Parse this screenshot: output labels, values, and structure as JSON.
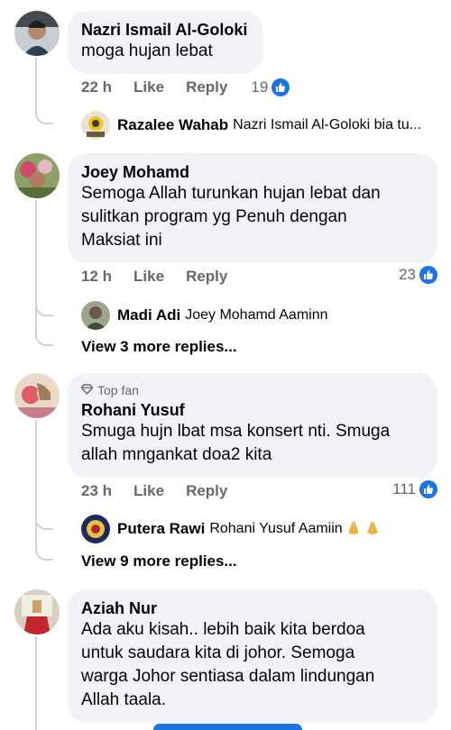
{
  "comments": [
    {
      "author": "Nazri Ismail Al-Goloki",
      "text": "moga hujan lebat",
      "time": "22 h",
      "like_label": "Like",
      "reply_label": "Reply",
      "reactions": "19",
      "reply_preview": {
        "name": "Razalee Wahab",
        "text": "Nazri Ismail Al-Goloki bia tu..."
      }
    },
    {
      "author": "Joey Mohamd",
      "text": "Semoga Allah turunkan hujan lebat dan\nsulitkan program yg Penuh dengan\nMaksiat ini",
      "time": "12 h",
      "like_label": "Like",
      "reply_label": "Reply",
      "reactions": "23",
      "reply_preview": {
        "name": "Madi Adi",
        "text": "Joey Mohamd Aaminn"
      },
      "more_replies": "View 3 more replies..."
    },
    {
      "badge": "Top fan",
      "author": "Rohani Yusuf",
      "text": "Smuga hujn lbat msa konsert nti. Smuga\nallah mngankat doa2 kita",
      "time": "23 h",
      "like_label": "Like",
      "reply_label": "Reply",
      "reactions": "111",
      "reply_preview": {
        "name": "Putera Rawi",
        "text": "Rohani Yusuf Aamiin"
      },
      "more_replies": "View 9 more replies..."
    },
    {
      "author": "Aziah Nur",
      "text": "Ada aku kisah.. lebih baik kita berdoa\nuntuk saudara kita di johor. Semoga\nwarga Johor  sentiasa dalam lindungan\nAllah taala."
    }
  ],
  "colors": {
    "like_blue": "#1b74e4",
    "bubble_bg": "#f0f2f5",
    "muted": "#65676b",
    "thread": "#ced0d4"
  },
  "icons": {
    "reaction": "like-thumb-icon",
    "top_fan": "diamond-badge-icon",
    "emoji": "praying-hands-icon"
  }
}
